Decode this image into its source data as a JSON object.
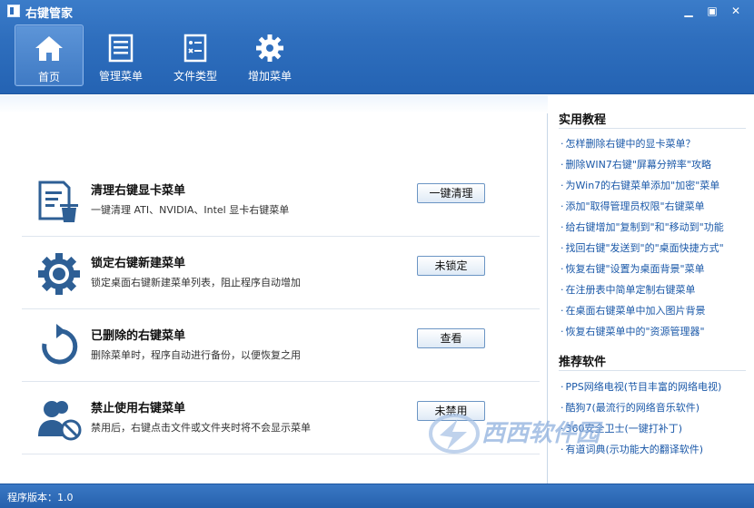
{
  "window": {
    "title": "右键管家",
    "controls": [
      "minimize",
      "restore",
      "close"
    ]
  },
  "toolbar": {
    "items": [
      {
        "label": "首页",
        "icon": "home-icon",
        "active": true
      },
      {
        "label": "管理菜单",
        "icon": "list-icon",
        "active": false
      },
      {
        "label": "文件类型",
        "icon": "file-types-icon",
        "active": false
      },
      {
        "label": "增加菜单",
        "icon": "gear-icon",
        "active": false
      }
    ]
  },
  "main": {
    "cards": [
      {
        "title": "清理右键显卡菜单",
        "desc": "一键清理 ATI、NVIDIA、Intel 显卡右键菜单",
        "button": "一键清理",
        "icon": "clean-icon"
      },
      {
        "title": "锁定右键新建菜单",
        "desc": "锁定桌面右键新建菜单列表，阻止程序自动增加",
        "button": "未锁定",
        "icon": "gear-icon"
      },
      {
        "title": "已删除的右键菜单",
        "desc": "删除菜单时，程序自动进行备份，以便恢复之用",
        "button": "查看",
        "icon": "restore-icon"
      },
      {
        "title": "禁止使用右键菜单",
        "desc": "禁用后，右键点击文件或文件夹时将不会显示菜单",
        "button": "未禁用",
        "icon": "user-block-icon"
      }
    ]
  },
  "side": {
    "tutorials_title": "实用教程",
    "tutorials": [
      "怎样删除右键中的显卡菜单？",
      "删除WIN7右键\"屏幕分辨率\"攻略",
      "为Win7的右键菜单添加\"加密\"菜单",
      "添加\"取得管理员权限\"右键菜单",
      "给右键增加\"复制到\"和\"移动到\"功能",
      "找回右键\"发送到\"的\"桌面快捷方式\"",
      "恢复右键\"设置为桌面背景\"菜单",
      "在注册表中简单定制右键菜单",
      "在桌面右键菜单中加入图片背景",
      "恢复右键菜单中的\"资源管理器\""
    ],
    "software_title": "推荐软件",
    "software": [
      "PPS网络电视(节目丰富的网络电视)",
      "酷狗7(最流行的网络音乐软件)",
      "360安全卫士(一键打补丁)",
      "有道词典(示功能大的翻译软件)"
    ]
  },
  "watermark": "西西软件园",
  "status": {
    "text": "程序版本：1.0"
  },
  "colors": {
    "titlebar": "#2f6fbe",
    "accent": "#1a58a8",
    "status": "#2661ad"
  }
}
